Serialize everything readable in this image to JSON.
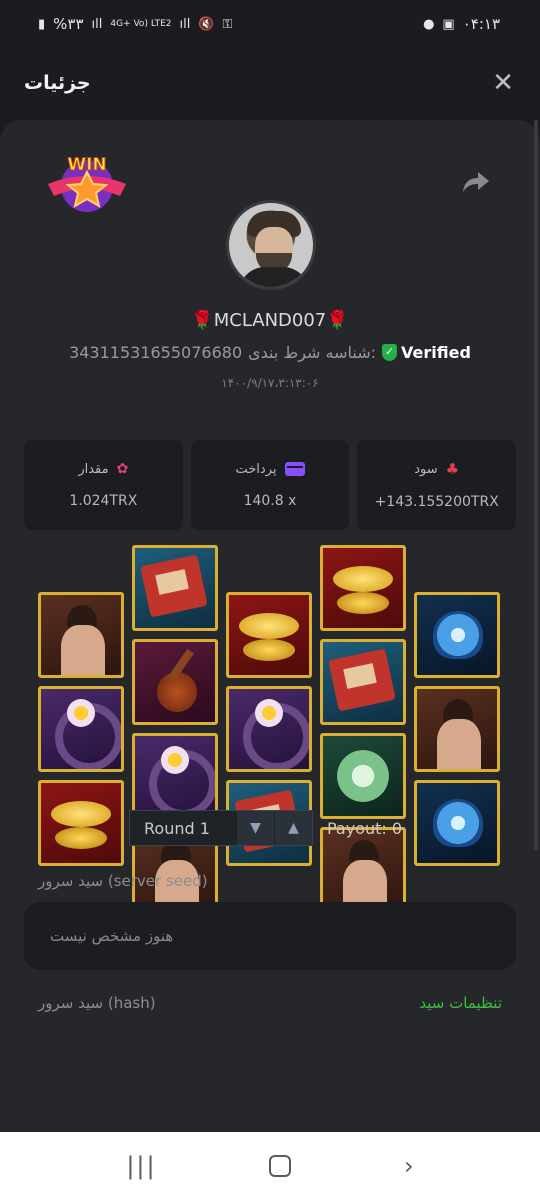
{
  "status_bar": {
    "battery": "%۳۳",
    "network": "4G+ Vo) LTE2",
    "time": "۰۴:۱۳"
  },
  "header": {
    "title": "جزئیات",
    "close_icon": "close-icon"
  },
  "profile": {
    "win_badge": "WIN",
    "username": "🌹MCLAND007🌹",
    "verified_label": "Verified",
    "bet_id_label": "شناسه شرط بندی:",
    "bet_id": "34311531655076680",
    "datetime": "۱۴۰۰/۹/۱۷،۳:۱۳:۰۶"
  },
  "stats": [
    {
      "label": "سود",
      "value": "+143.155200TRX",
      "icon": "profit-icon"
    },
    {
      "label": "پرداخت",
      "value": "140.8 x",
      "icon": "card-icon"
    },
    {
      "label": "مقدار",
      "value": "1.024TRX",
      "icon": "amount-icon"
    }
  ],
  "reels": [
    [
      "woman",
      "ring",
      "gold"
    ],
    [
      "book",
      "lute",
      "ring",
      "woman"
    ],
    [
      "gold",
      "ring",
      "book"
    ],
    [
      "gold",
      "book",
      "jade",
      "woman"
    ],
    [
      "lotus",
      "woman",
      "lotus"
    ]
  ],
  "round": {
    "label": "Round 1",
    "payout": "Payout: 0"
  },
  "server_seed": {
    "label": "سید سرور (server seed)",
    "value": "هنوز مشخص نیست"
  },
  "hash": {
    "label": "سید سرور (hash)",
    "settings_link": "تنظیمات سید"
  },
  "colors": {
    "background": "#1b1c1f",
    "card": "#26272b",
    "accent_green": "#3fbf3f",
    "frame_gold": "#d9b032"
  }
}
